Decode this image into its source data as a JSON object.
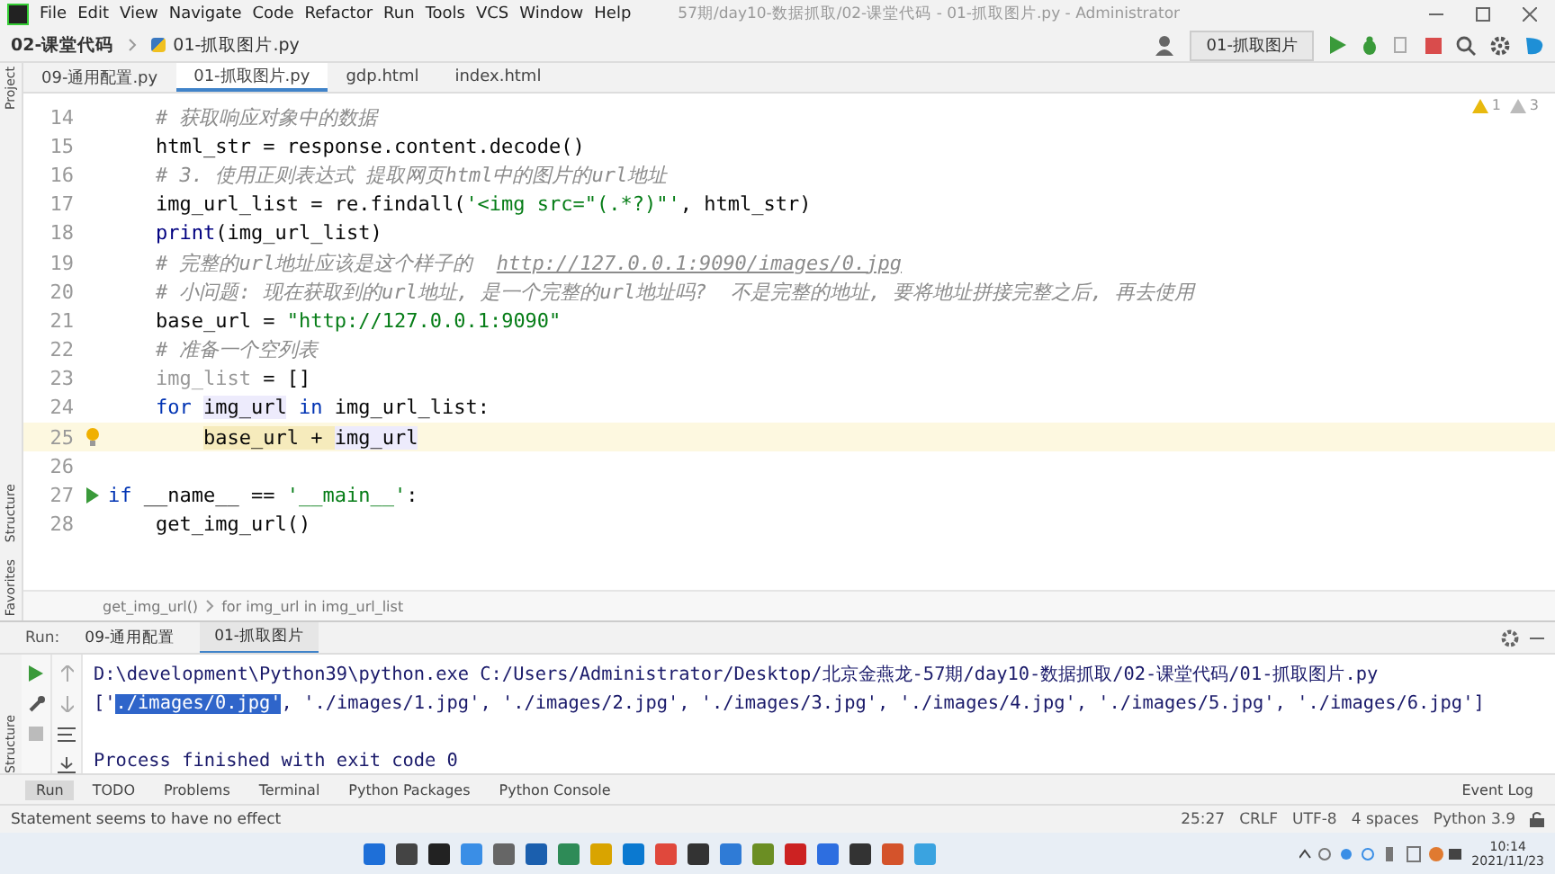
{
  "menu": [
    "File",
    "Edit",
    "View",
    "Navigate",
    "Code",
    "Refactor",
    "Run",
    "Tools",
    "VCS",
    "Window",
    "Help"
  ],
  "window_title": "57期/day10-数据抓取/02-课堂代码 - 01-抓取图片.py - Administrator",
  "breadcrumb": [
    "02-课堂代码",
    "01-抓取图片.py"
  ],
  "run_config": "01-抓取图片",
  "editor_tabs": [
    {
      "label": "09-通用配置.py",
      "selected": false
    },
    {
      "label": "01-抓取图片.py",
      "selected": true
    },
    {
      "label": "gdp.html",
      "selected": false
    },
    {
      "label": "index.html",
      "selected": false
    }
  ],
  "inspections": {
    "warnings": "1",
    "weak_warnings": "3"
  },
  "side_tools_top": [
    "Project"
  ],
  "side_tools_bottom": [
    "Structure",
    "Favorites"
  ],
  "code_lines": [
    {
      "number": "14",
      "current": false,
      "segments": [
        {
          "kind": "comment",
          "text": "    # 获取响应对象中的数据"
        }
      ]
    },
    {
      "number": "15",
      "current": false,
      "segments": [
        {
          "kind": "plain",
          "text": "    html_str = response.content.decode()"
        }
      ]
    },
    {
      "number": "16",
      "current": false,
      "segments": [
        {
          "kind": "comment",
          "text": "    # 3. 使用正则表达式 提取网页html中的图片的url地址"
        }
      ]
    },
    {
      "number": "17",
      "current": false,
      "segments": [
        {
          "kind": "plain",
          "text": "    img_url_list = re.findall("
        },
        {
          "kind": "string",
          "text": "'<img src=\"(.*?)\"'"
        },
        {
          "kind": "plain",
          "text": ", html_str)"
        }
      ]
    },
    {
      "number": "18",
      "current": false,
      "segments": [
        {
          "kind": "builtin",
          "text": "    print"
        },
        {
          "kind": "plain",
          "text": "(img_url_list)"
        }
      ]
    },
    {
      "number": "19",
      "current": false,
      "segments": [
        {
          "kind": "comment",
          "text": "    # 完整的url地址应该是这个样子的  "
        },
        {
          "kind": "link",
          "text": "http://127.0.0.1:9090/images/0.jpg"
        }
      ]
    },
    {
      "number": "20",
      "current": false,
      "segments": [
        {
          "kind": "comment",
          "text": "    # 小问题: 现在获取到的url地址, 是一个完整的url地址吗?  不是完整的地址, 要将地址拼接完整之后, 再去使用"
        }
      ]
    },
    {
      "number": "21",
      "current": false,
      "segments": [
        {
          "kind": "plain",
          "text": "    base_url = "
        },
        {
          "kind": "string",
          "text": "\"http://127.0.0.1:9090\""
        }
      ]
    },
    {
      "number": "22",
      "current": false,
      "segments": [
        {
          "kind": "comment",
          "text": "    # 准备一个空列表"
        }
      ]
    },
    {
      "number": "23",
      "current": false,
      "segments": [
        {
          "kind": "unused",
          "text": "    img_list"
        },
        {
          "kind": "plain",
          "text": " = []"
        }
      ]
    },
    {
      "number": "24",
      "current": false,
      "segments": [
        {
          "kind": "keyword",
          "text": "    for"
        },
        {
          "kind": "variable",
          "text": " img_url"
        },
        {
          "kind": "keyword",
          "text": " in"
        },
        {
          "kind": "plain",
          "text": " img_url_list:"
        }
      ]
    },
    {
      "number": "25",
      "current": true,
      "gutter": {
        "kind": "bulb"
      },
      "segments": [
        {
          "kind": "warning",
          "text": "        base_url + "
        },
        {
          "kind": "variable",
          "text": "img_url"
        }
      ]
    },
    {
      "number": "26",
      "current": false
    },
    {
      "number": "27",
      "current": false,
      "gutter": {
        "kind": "run"
      },
      "segments": [
        {
          "kind": "keyword",
          "text": "if"
        },
        {
          "kind": "plain",
          "text": " __name__ == "
        },
        {
          "kind": "string",
          "text": "'__main__'"
        },
        {
          "kind": "plain",
          "text": ":"
        }
      ]
    },
    {
      "number": "28",
      "current": false,
      "segments": [
        {
          "kind": "plain",
          "text": "    get_img_url()"
        }
      ]
    }
  ],
  "editor_breadcrumb": [
    "get_img_url()",
    "for img_url in img_url_list"
  ],
  "run_panel": {
    "label": "Run:",
    "side_tool": "Structure",
    "tabs": [
      {
        "label": "09-通用配置",
        "selected": false
      },
      {
        "label": "01-抓取图片",
        "selected": true
      }
    ],
    "output": [
      {
        "kind": "text",
        "segments": [
          {
            "kind": "plain",
            "text": "D:\\development\\Python39\\python.exe C:/Users/Administrator/Desktop/北京金燕龙-57期/day10-数据抓取/02-课堂代码/01-抓取图片.py"
          }
        ]
      },
      {
        "kind": "text",
        "segments": [
          {
            "kind": "plain",
            "text": "['"
          },
          {
            "kind": "selected",
            "text": "./images/0.jpg'"
          },
          {
            "kind": "plain",
            "text": ", './images/1.jpg', './images/2.jpg', './images/3.jpg', './images/4.jpg', './images/5.jpg', './images/6.jpg']"
          }
        ]
      },
      {
        "kind": "blank"
      },
      {
        "kind": "text",
        "segments": [
          {
            "kind": "plain",
            "text": "Process finished with exit code 0"
          }
        ]
      }
    ]
  },
  "tool_tabs": [
    {
      "label": "Run",
      "selected": true
    },
    {
      "label": "TODO",
      "selected": false
    },
    {
      "label": "Problems",
      "selected": false
    },
    {
      "label": "Terminal",
      "selected": false
    },
    {
      "label": "Python Packages",
      "selected": false
    },
    {
      "label": "Python Console",
      "selected": false
    }
  ],
  "event_log": "Event Log",
  "status_message": "Statement seems to have no effect",
  "status_items": [
    "25:27",
    "CRLF",
    "UTF-8",
    "4 spaces",
    "Python 3.9"
  ],
  "taskbar": {
    "time": "10:14",
    "date": "2021/11/23"
  }
}
